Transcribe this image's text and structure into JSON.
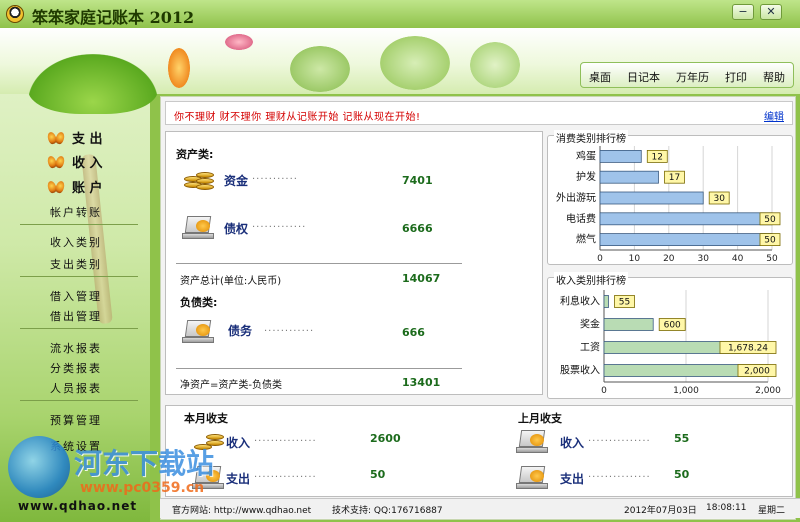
{
  "window": {
    "title": "笨笨家庭记账本 2012",
    "minimize_label": "−",
    "close_label": "✕",
    "accent": "#8fc24a"
  },
  "menu": {
    "items": [
      "桌面",
      "日记本",
      "万年历",
      "打印",
      "帮助"
    ]
  },
  "sidebar": {
    "main": [
      "支 出",
      "收 入",
      "账 户"
    ],
    "groups": [
      [
        "帐户转账"
      ],
      [
        "收入类别",
        "支出类别"
      ],
      [
        "借入管理",
        "借出管理"
      ],
      [
        "流水报表",
        "分类报表",
        "人员报表"
      ],
      [
        "预算管理",
        "系统设置"
      ]
    ],
    "site": "www.qdhao.net"
  },
  "slogan": {
    "text": "你不理财  财不理你  理财从记账开始  记账从现在开始!",
    "edit_label": "编辑"
  },
  "assets": {
    "title": "资产类:",
    "rows": [
      {
        "label": "资金",
        "dots": "···········",
        "value": "7401"
      },
      {
        "label": "债权",
        "dots": "·············",
        "value": "6666"
      }
    ],
    "total_label": "资产总计(单位:人民币)",
    "total_value": "14067",
    "liabilities_title": "负债类:",
    "liabilities": [
      {
        "label": "债务",
        "dots": "············",
        "value": "666"
      }
    ],
    "net_label": "净资产=资产类-负债类",
    "net_value": "13401"
  },
  "chart_data": [
    {
      "type": "bar",
      "orientation": "horizontal",
      "title": "消费类别排行榜",
      "categories": [
        "鸡蛋",
        "护发",
        "外出游玩",
        "电话费",
        "燃气"
      ],
      "values": [
        12,
        17,
        30,
        50,
        50
      ],
      "value_labels": [
        "12",
        "17",
        "30",
        "50",
        "50"
      ],
      "xlim": [
        0,
        50
      ],
      "ticks": [
        0,
        10,
        20,
        30,
        40,
        50
      ],
      "tick_labels": [
        "0",
        "10",
        "20",
        "30",
        "40",
        "50"
      ],
      "bar_color": "#9fc3ea",
      "grid": true
    },
    {
      "type": "bar",
      "orientation": "horizontal",
      "title": "收入类别排行榜",
      "categories": [
        "利息收入",
        "奖金",
        "工资",
        "股票收入"
      ],
      "values": [
        55,
        600,
        1678.24,
        2000
      ],
      "value_labels": [
        "55",
        "600",
        "1,678.24",
        "2,000"
      ],
      "xlim": [
        0,
        2000
      ],
      "ticks": [
        0,
        1000,
        2000
      ],
      "tick_labels": [
        "0",
        "1,000",
        "2,000"
      ],
      "bar_color": "#b9dcb4",
      "grid": true
    }
  ],
  "this_month": {
    "title": "本月收支",
    "income_label": "收入",
    "income_dots": "···············",
    "income_value": "2600",
    "expense_label": "支出",
    "expense_dots": "···············",
    "expense_value": "50"
  },
  "last_month": {
    "title": "上月收支",
    "income_label": "收入",
    "income_dots": "···············",
    "income_value": "55",
    "expense_label": "支出",
    "expense_dots": "···············",
    "expense_value": "50"
  },
  "status": {
    "website": "官方网站: http://www.qdhao.net",
    "support": "技术支持: QQ:176716887",
    "date": "2012年07月03日",
    "time": "18:08:11",
    "weekday": "星期二"
  },
  "watermark": {
    "text": "河东下载站",
    "url": "www.pc0359.cn"
  }
}
